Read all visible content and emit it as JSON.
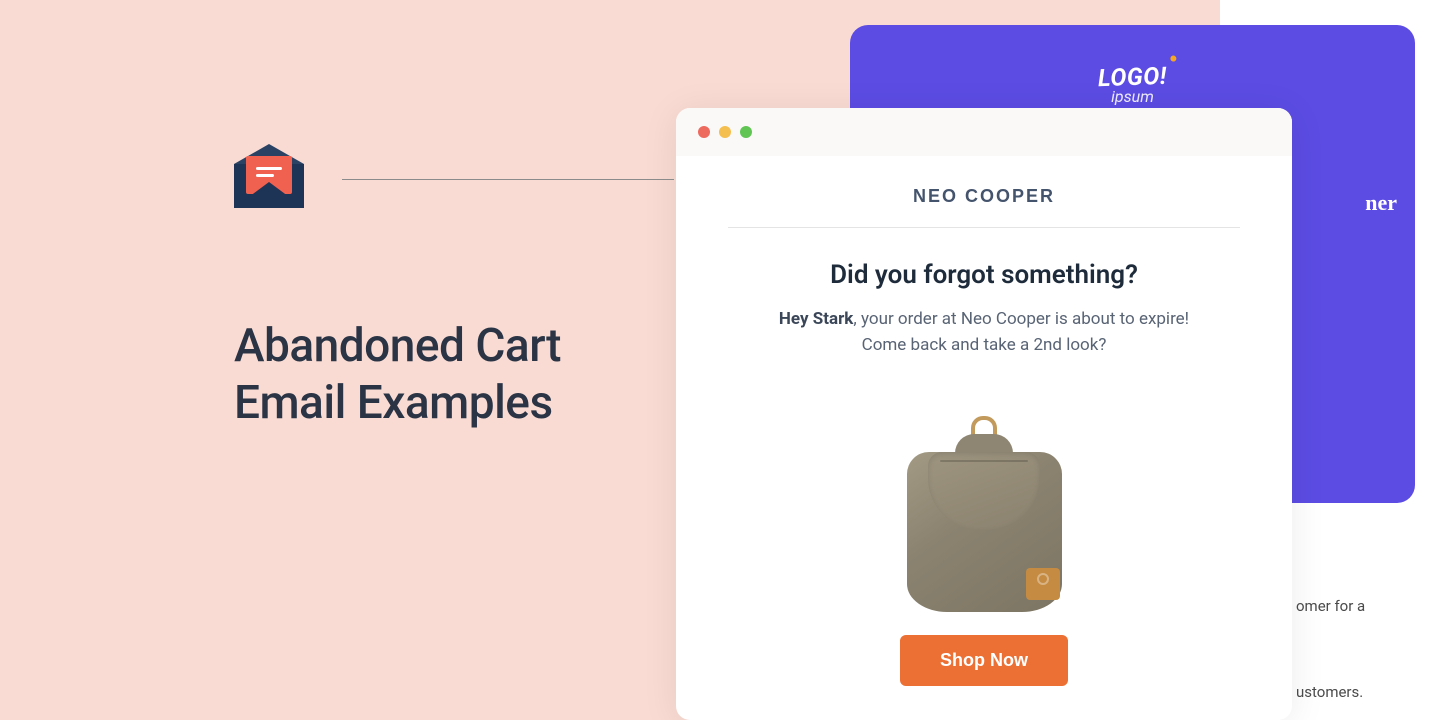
{
  "page_heading": "Abandoned Cart Email Examples",
  "purple_card": {
    "logo_main": "LOGO!",
    "logo_sub": "ipsum",
    "peek_text": "ner"
  },
  "email": {
    "brand": "NEO COOPER",
    "headline": "Did you forgot something?",
    "greeting_name": "Hey Stark",
    "message_line1": ", your order at Neo Cooper is about to expire!",
    "message_line2": "Come back and take a 2nd look?",
    "cta": "Shop Now"
  },
  "side_fragments": {
    "frag1": "omer for a",
    "frag2": "ustomers."
  }
}
